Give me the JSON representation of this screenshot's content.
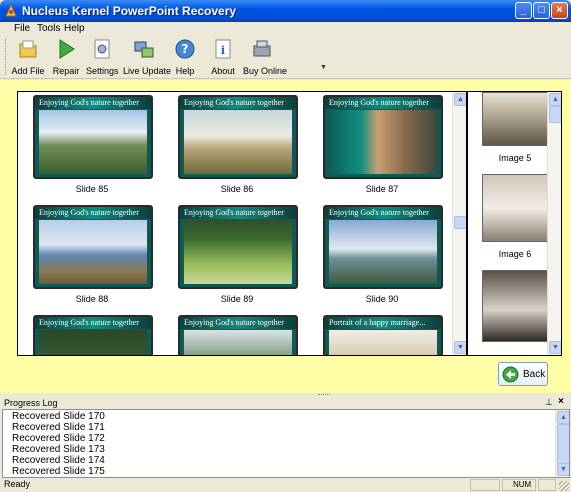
{
  "window": {
    "title": "Nucleus Kernel PowerPoint Recovery"
  },
  "menu": [
    "File",
    "Tools",
    "Help"
  ],
  "toolbar": {
    "buttons": [
      {
        "label": "Add File",
        "icon": "add-file-icon"
      },
      {
        "label": "Repair",
        "icon": "repair-play-icon"
      },
      {
        "label": "Settings",
        "icon": "settings-icon"
      },
      {
        "label": "Live Update",
        "icon": "live-update-icon"
      },
      {
        "label": "Help",
        "icon": "help-icon"
      },
      {
        "label": "About",
        "icon": "about-icon"
      },
      {
        "label": "Buy Online",
        "icon": "buy-online-icon"
      }
    ],
    "overflow_icon": "chevron-down-icon"
  },
  "slides": [
    {
      "label": "Slide 85",
      "caption": "Enjoying God's nature together",
      "scene": "mountains"
    },
    {
      "label": "Slide 86",
      "caption": "Enjoying God's nature together",
      "scene": "path"
    },
    {
      "label": "Slide 87",
      "caption": "Enjoying God's nature together",
      "scene": "couple"
    },
    {
      "label": "Slide 88",
      "caption": "Enjoying God's nature together",
      "scene": "lake"
    },
    {
      "label": "Slide 89",
      "caption": "Enjoying God's nature together",
      "scene": "garden"
    },
    {
      "label": "Slide 90",
      "caption": "Enjoying God's nature together",
      "scene": "alps"
    },
    {
      "label": "",
      "caption": "Enjoying God's nature together",
      "scene": "forest"
    },
    {
      "label": "",
      "caption": "Enjoying God's nature together",
      "scene": "trees"
    },
    {
      "label": "",
      "caption": "Portrait of a happy marriage...",
      "scene": "portrait"
    }
  ],
  "images": [
    {
      "label": "Image 5"
    },
    {
      "label": "Image 6"
    },
    {
      "label": ""
    }
  ],
  "back_button": {
    "label": "Back",
    "icon": "back-arrow-icon"
  },
  "progress_log": {
    "title": "Progress Log",
    "lines": [
      "Recovered Slide 170",
      "Recovered Slide 171",
      "Recovered Slide 172",
      "Recovered Slide 173",
      "Recovered Slide 174",
      "Recovered Slide 175"
    ],
    "pin_icon": "pin-icon",
    "close_icon": "close-icon"
  },
  "status": {
    "text": "Ready",
    "num": "NUM"
  },
  "colors": {
    "titlebar": "#0054E3",
    "workspace": "#FFFDA6",
    "slide_band": "#128a80"
  }
}
